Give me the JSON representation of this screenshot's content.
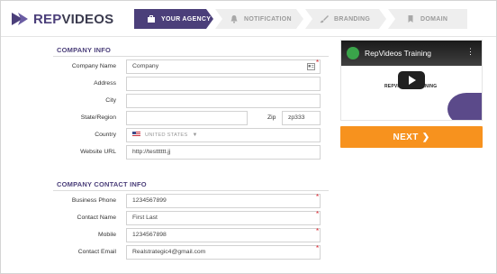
{
  "brand": {
    "name_part1": "REP",
    "name_part2": "VIDEOS"
  },
  "steps": [
    {
      "label": "YOUR AGENCY",
      "icon": "briefcase-icon",
      "active": true
    },
    {
      "label": "NOTIFICATION",
      "icon": "bell-icon",
      "active": false
    },
    {
      "label": "BRANDING",
      "icon": "brush-icon",
      "active": false
    },
    {
      "label": "DOMAIN",
      "icon": "bookmark-icon",
      "active": false
    }
  ],
  "company_info": {
    "title": "COMPANY INFO",
    "company_name": {
      "label": "Company Name",
      "value": "Company"
    },
    "address": {
      "label": "Address",
      "value": ""
    },
    "city": {
      "label": "City",
      "value": ""
    },
    "state": {
      "label": "State/Region",
      "value": ""
    },
    "zip": {
      "label": "Zip",
      "value": "zp333"
    },
    "country": {
      "label": "Country",
      "value": "UNITED STATES"
    },
    "website": {
      "label": "Website URL",
      "value": "http://testttttt.jj"
    }
  },
  "contact_info": {
    "title": "COMPANY CONTACT INFO",
    "business_phone": {
      "label": "Business Phone",
      "value": "1234567899"
    },
    "contact_name": {
      "label": "Contact Name",
      "value": "First Last"
    },
    "mobile": {
      "label": "Mobile",
      "value": "1234567898"
    },
    "contact_email": {
      "label": "Contact Email",
      "value": "Realstrategic4@gmail.com"
    }
  },
  "video": {
    "title": "RepVideos Training",
    "logo_text": "REPVIDEOS TRAINING"
  },
  "next_button": {
    "label": "NEXT"
  },
  "colors": {
    "brand": "#4b3f7a",
    "accent": "#f7921e",
    "required": "#d9232d"
  }
}
